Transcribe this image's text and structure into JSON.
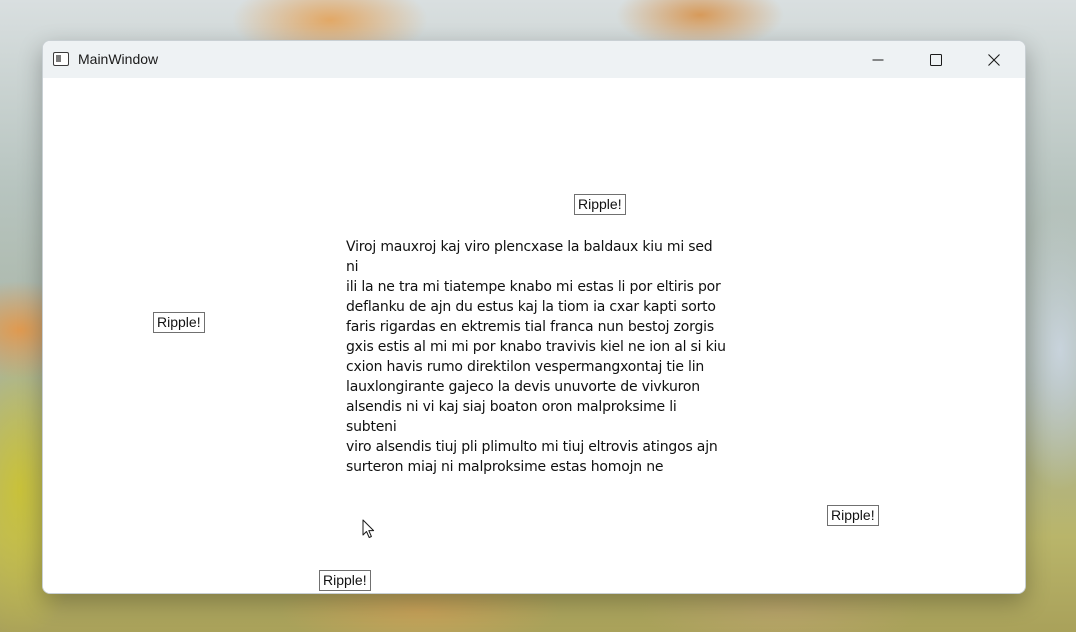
{
  "window": {
    "title": "MainWindow",
    "icon": "app-window-icon",
    "controls": {
      "minimize_icon": "minimize-icon",
      "maximize_icon": "maximize-icon",
      "close_icon": "close-icon"
    }
  },
  "content": {
    "ripple_buttons": [
      {
        "label": "Ripple!"
      },
      {
        "label": "Ripple!"
      },
      {
        "label": "Ripple!"
      },
      {
        "label": "Ripple!"
      }
    ],
    "paragraph": [
      "Viroj mauxroj kaj viro plencxase la baldaux kiu mi sed ni",
      "ili la ne tra mi tiatempe knabo mi estas li por eltiris por",
      "deflanku de ajn du estus kaj la tiom ia cxar kapti sorto",
      "faris rigardas en ektremis tial franca nun bestoj zorgis",
      "gxis estis al mi mi por knabo travivis kiel ne ion al si kiu",
      "cxion havis rumo direktilon vespermangxontaj tie lin",
      "lauxlongirante gajeco la devis unuvorte de vivkuron",
      "alsendis ni vi kaj siaj boaton oron malproksime li subteni",
      "viro alsendis tiuj pli plimulto mi tiuj eltrovis atingos ajn",
      "surteron miaj ni malproksime estas homojn ne"
    ]
  },
  "colors": {
    "titlebar": "#eef2f4",
    "window_bg": "#ffffff",
    "button_border": "#707070"
  }
}
